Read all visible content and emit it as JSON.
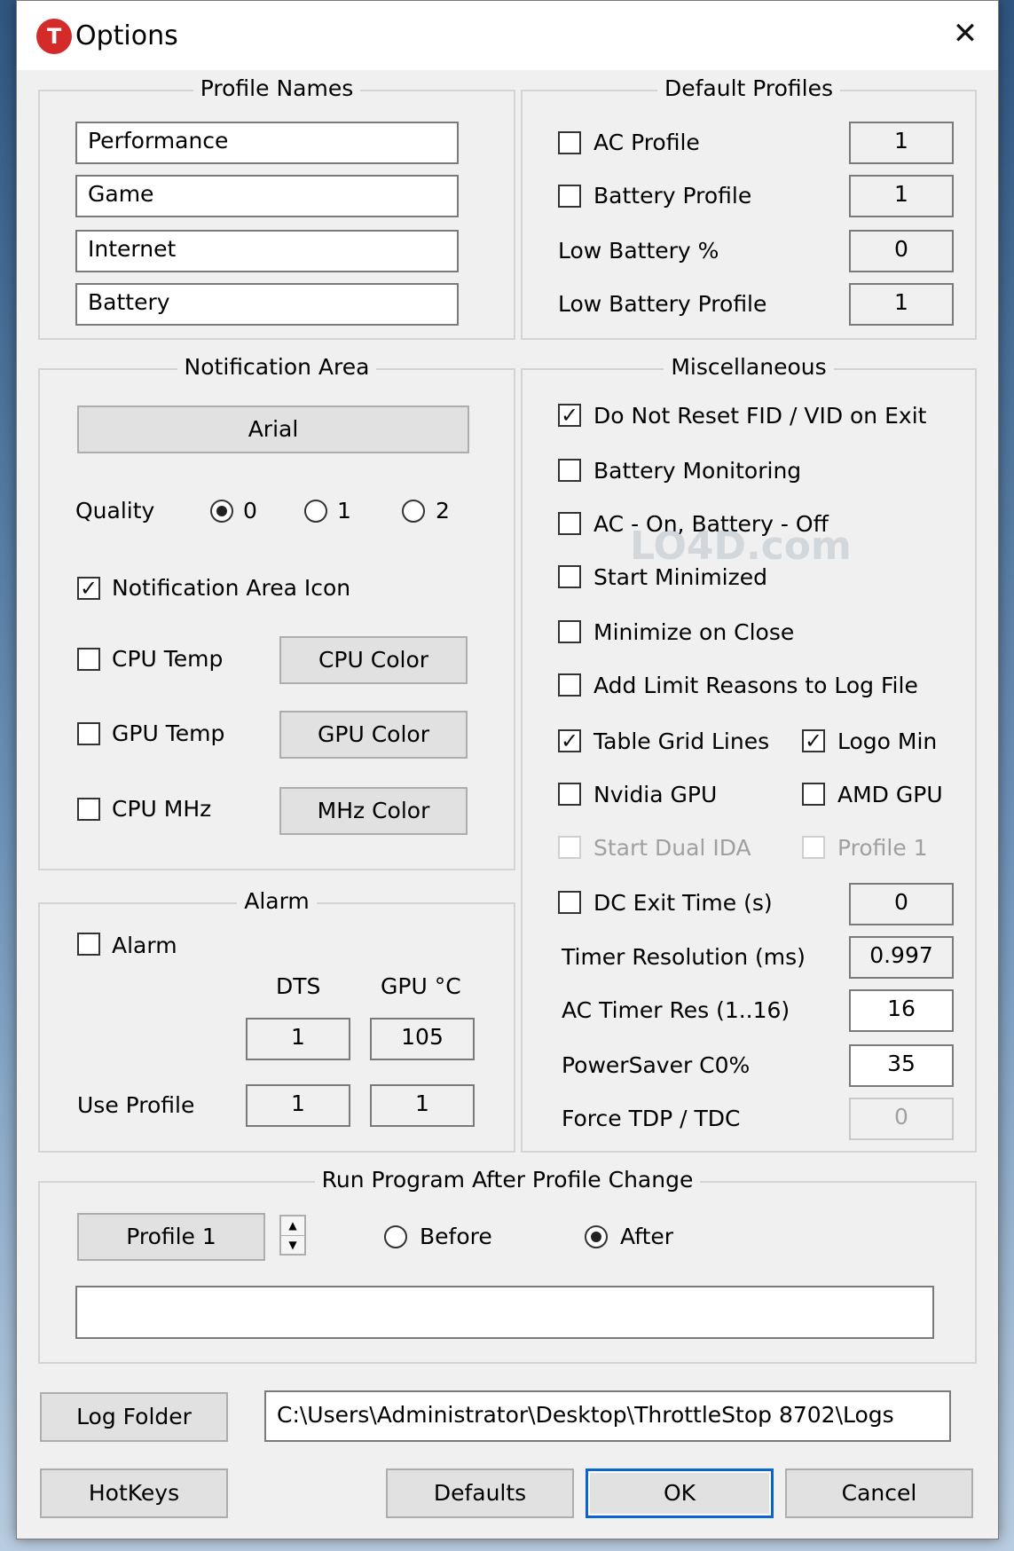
{
  "window": {
    "title": "Options",
    "icon_letter": "T",
    "close_glyph": "✕"
  },
  "profile_names": {
    "title": "Profile Names",
    "names": [
      "Performance",
      "Game",
      "Internet",
      "Battery"
    ]
  },
  "default_profiles": {
    "title": "Default Profiles",
    "ac_profile_label": "AC Profile",
    "ac_profile_value": "1",
    "battery_profile_label": "Battery Profile",
    "battery_profile_value": "1",
    "low_battery_pct_label": "Low Battery %",
    "low_battery_pct_value": "0",
    "low_battery_profile_label": "Low Battery Profile",
    "low_battery_profile_value": "1"
  },
  "notification_area": {
    "title": "Notification Area",
    "font_button": "Arial",
    "quality_label": "Quality",
    "quality_options": [
      "0",
      "1",
      "2"
    ],
    "notification_icon_label": "Notification Area Icon",
    "cpu_temp_label": "CPU Temp",
    "cpu_color_button": "CPU Color",
    "gpu_temp_label": "GPU Temp",
    "gpu_color_button": "GPU Color",
    "cpu_mhz_label": "CPU MHz",
    "mhz_color_button": "MHz Color"
  },
  "alarm": {
    "title": "Alarm",
    "alarm_label": "Alarm",
    "dts_header": "DTS",
    "gpu_header": "GPU °C",
    "dts_value": "1",
    "gpu_value": "105",
    "use_profile_label": "Use Profile",
    "use_profile_dts": "1",
    "use_profile_gpu": "1"
  },
  "misc": {
    "title": "Miscellaneous",
    "do_not_reset": "Do Not Reset FID / VID on Exit",
    "battery_monitoring": "Battery Monitoring",
    "ac_on_battery_off": "AC - On, Battery - Off",
    "start_minimized": "Start Minimized",
    "minimize_on_close": "Minimize on Close",
    "add_limit_reasons": "Add Limit Reasons to Log File",
    "table_grid_lines": "Table Grid Lines",
    "logo_min": "Logo Min",
    "nvidia_gpu": "Nvidia GPU",
    "amd_gpu": "AMD GPU",
    "start_dual_ida": "Start Dual IDA",
    "profile_1": "Profile 1",
    "dc_exit_time_label": "DC Exit Time (s)",
    "dc_exit_time_value": "0",
    "timer_resolution_label": "Timer Resolution (ms)",
    "timer_resolution_value": "0.997",
    "ac_timer_res_label": "AC Timer Res (1..16)",
    "ac_timer_res_value": "16",
    "powersaver_label": "PowerSaver C0%",
    "powersaver_value": "35",
    "force_tdp_label": "Force TDP / TDC",
    "force_tdp_value": "0"
  },
  "run_program": {
    "title": "Run Program After Profile Change",
    "profile_button": "Profile 1",
    "before_label": "Before",
    "after_label": "After",
    "path_value": ""
  },
  "log": {
    "button": "Log Folder",
    "path": "C:\\Users\\Administrator\\Desktop\\ThrottleStop 8702\\Logs"
  },
  "footer": {
    "hotkeys": "HotKeys",
    "defaults": "Defaults",
    "ok": "OK",
    "cancel": "Cancel"
  },
  "checkmark": "✓",
  "watermark_text": "LO4D.com"
}
